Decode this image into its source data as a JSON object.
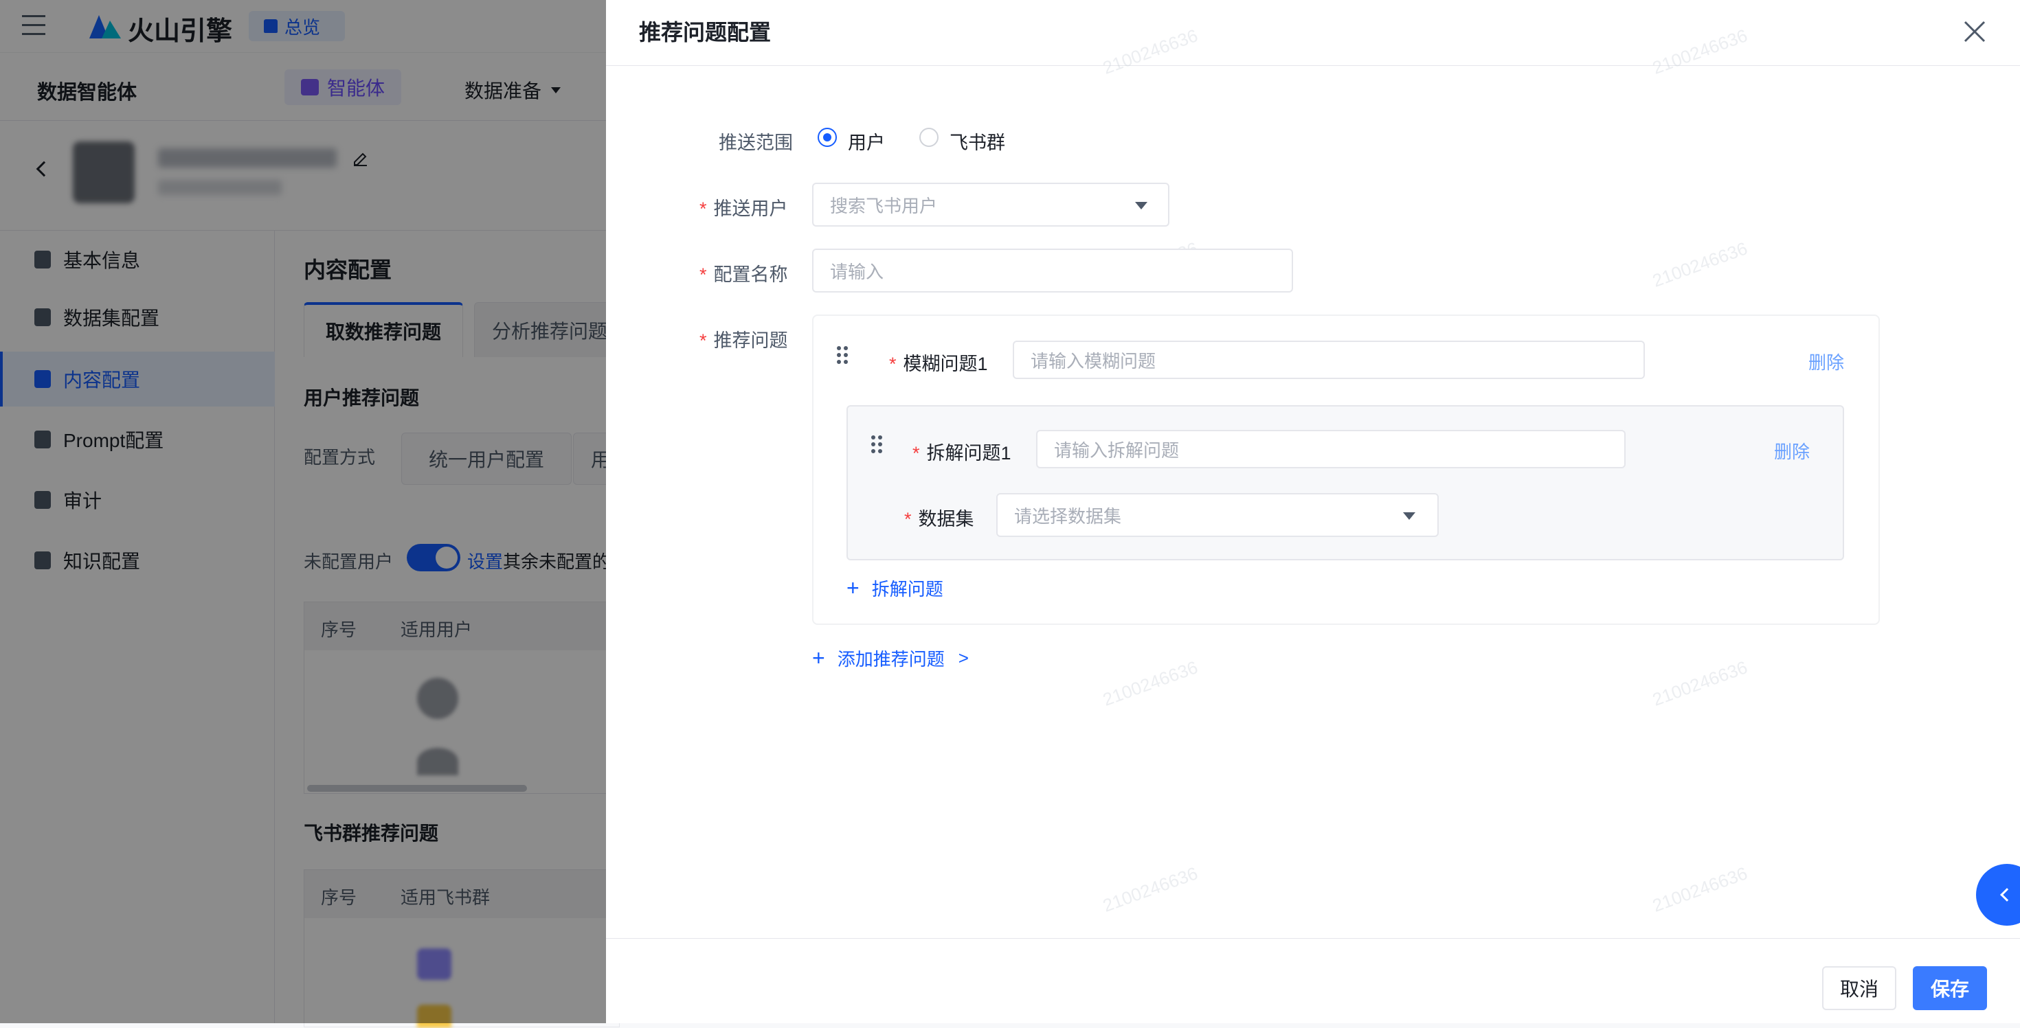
{
  "app": {
    "brand": "火山引擎",
    "overview": "总览",
    "product": "数据智能体",
    "nav": [
      {
        "label": "智能体"
      },
      {
        "label": "数据准备"
      }
    ]
  },
  "sidebar": {
    "items": [
      {
        "label": "基本信息",
        "icon": "doc-icon"
      },
      {
        "label": "数据集配置",
        "icon": "layers-icon"
      },
      {
        "label": "内容配置",
        "icon": "content-icon"
      },
      {
        "label": "Prompt配置",
        "icon": "chart-icon"
      },
      {
        "label": "审计",
        "icon": "audit-icon"
      },
      {
        "label": "知识配置",
        "icon": "bulb-icon"
      }
    ]
  },
  "content": {
    "title": "内容配置",
    "tabs": [
      "取数推荐问题",
      "分析推荐问题"
    ],
    "user_section": "用户推荐问题",
    "config_mode_label": "配置方式",
    "config_mode_btn": "统一用户配置",
    "config_mode_btn2": "用",
    "unconfigured_label": "未配置用户",
    "set_link": "设置",
    "set_rest": "其余未配置的用",
    "table_cols": [
      "序号",
      "适用用户"
    ],
    "feishu_section": "飞书群推荐问题",
    "feishu_cols": [
      "序号",
      "适用飞书群"
    ]
  },
  "drawer": {
    "title": "推荐问题配置",
    "scope_label": "推送范围",
    "scope_options": [
      "用户",
      "飞书群"
    ],
    "scope_selected": "用户",
    "user_label": "推送用户",
    "user_placeholder": "搜索飞书用户",
    "name_label": "配置名称",
    "name_placeholder": "请输入",
    "question_label": "推荐问题",
    "fuzzy_label": "模糊问题1",
    "fuzzy_placeholder": "请输入模糊问题",
    "delete": "删除",
    "split_label": "拆解问题1",
    "split_placeholder": "请输入拆解问题",
    "dataset_label": "数据集",
    "dataset_placeholder": "请选择数据集",
    "add_split": "拆解问题",
    "add_question": "添加推荐问题",
    "add_question_arrow": ">",
    "cancel": "取消",
    "save": "保存"
  },
  "watermark": "2100246636",
  "colors": {
    "primary": "#165dff",
    "required": "#f53f3f",
    "mask": "rgba(0,0,0,0.45)"
  }
}
